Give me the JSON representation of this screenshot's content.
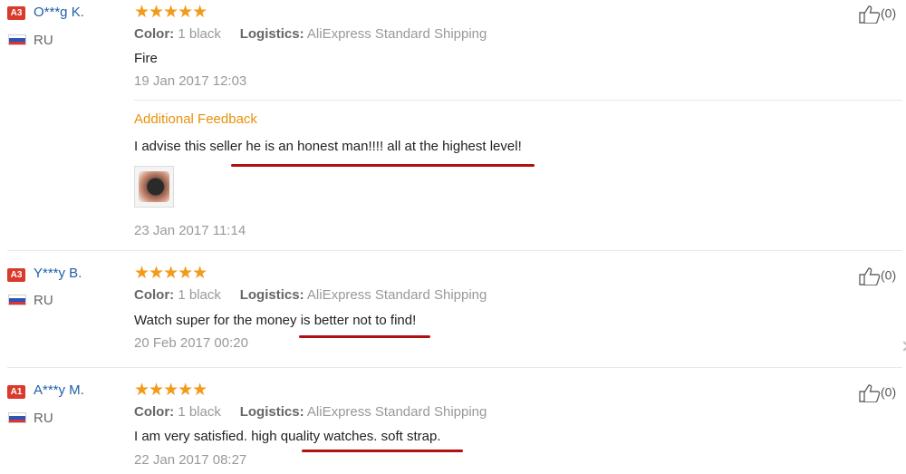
{
  "reviews": [
    {
      "level": "A3",
      "name": "O***g K.",
      "country": "RU",
      "rating": "★★★★★",
      "color_label": "Color:",
      "color_value": "1 black",
      "logistics_label": "Logistics:",
      "logistics_value": "AliExpress Standard Shipping",
      "text": "Fire",
      "date": "19 Jan 2017 12:03",
      "likes": "(0)",
      "additional": {
        "label": "Additional Feedback",
        "text": "I advise this seller he is an honest man!!!! all at the highest level!",
        "date": "23 Jan 2017 11:14"
      }
    },
    {
      "level": "A3",
      "name": "Y***y B.",
      "country": "RU",
      "rating": "★★★★★",
      "color_label": "Color:",
      "color_value": "1 black",
      "logistics_label": "Logistics:",
      "logistics_value": "AliExpress Standard Shipping",
      "text": "Watch super for the money is better not to find!",
      "date": "20 Feb 2017 00:20",
      "likes": "(0)"
    },
    {
      "level": "A1",
      "name": "A***y M.",
      "country": "RU",
      "rating": "★★★★★",
      "color_label": "Color:",
      "color_value": "1 black",
      "logistics_label": "Logistics:",
      "logistics_value": "AliExpress Standard Shipping",
      "text": "I am very satisfied. high quality watches. soft strap.",
      "date": "22 Jan 2017 08:27",
      "likes": "(0)"
    }
  ],
  "colors": {
    "accent": "#f29a1a",
    "link": "#1f5fa8",
    "badge": "#d93a2b",
    "underline": "#b01010"
  },
  "icons": {
    "like": "thumbs-up-icon",
    "flag": "russia-flag-icon"
  }
}
